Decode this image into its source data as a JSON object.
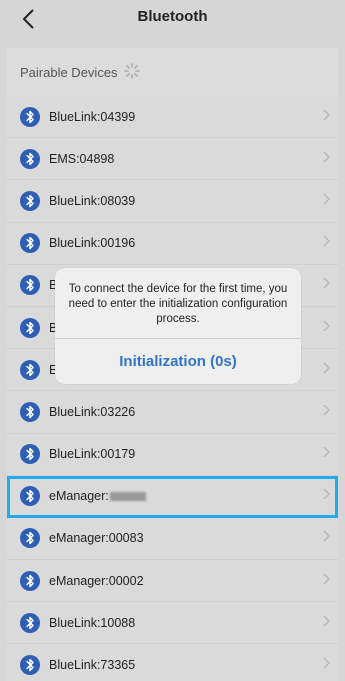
{
  "header": {
    "title": "Bluetooth",
    "back_icon": "chevron-left-icon"
  },
  "section": {
    "label": "Pairable Devices",
    "spinner_icon": "loading-spinner-icon"
  },
  "devices": [
    {
      "label": "BlueLink:04399"
    },
    {
      "label": "EMS:04898"
    },
    {
      "label": "BlueLink:08039"
    },
    {
      "label": "BlueLink:00196"
    },
    {
      "label": "B"
    },
    {
      "label": "B"
    },
    {
      "label": "E"
    },
    {
      "label": "BlueLink:03226"
    },
    {
      "label": "BlueLink:00179"
    },
    {
      "label": "eManager:",
      "redacted": true,
      "highlighted": true
    },
    {
      "label": "eManager:00083"
    },
    {
      "label": "eManager:00002"
    },
    {
      "label": "BlueLink:10088"
    },
    {
      "label": "BlueLink:73365"
    }
  ],
  "dialog": {
    "message": "To connect the device for the first time, you need to enter the initialization configuration process.",
    "button_label": "Initialization (0s)"
  },
  "colors": {
    "accent": "#3174c6",
    "bluetooth_icon": "#2f5fb5",
    "highlight": "#22aaee"
  }
}
